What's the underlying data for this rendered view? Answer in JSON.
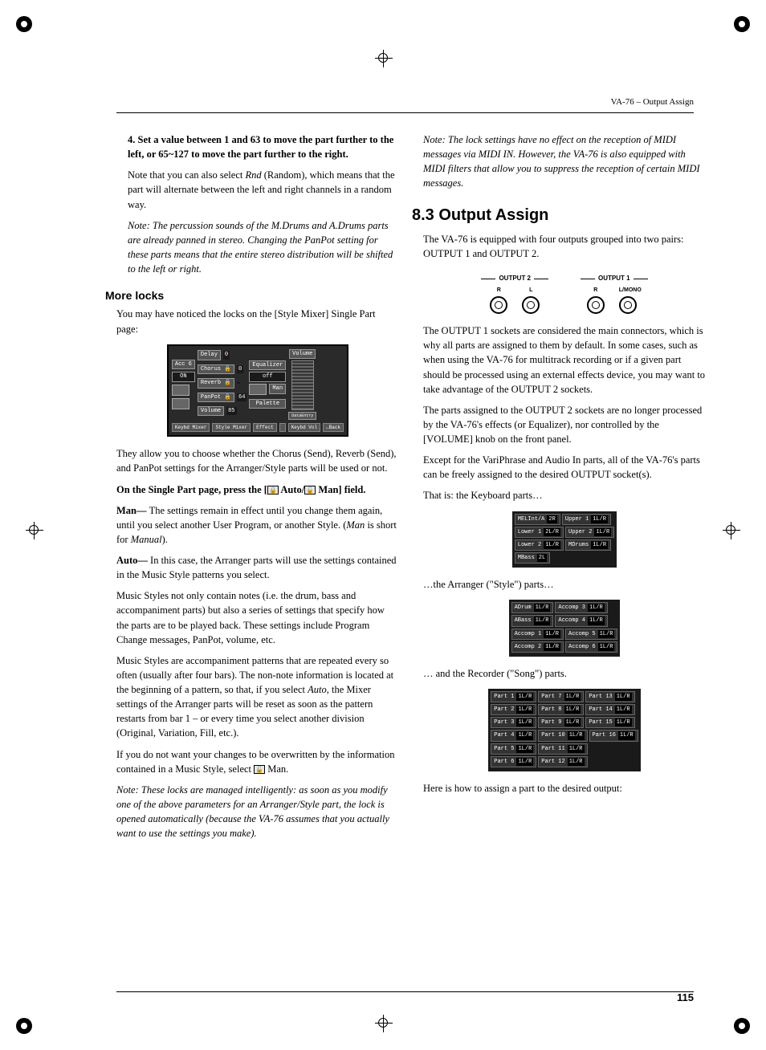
{
  "header": {
    "right": "VA-76 – Output Assign"
  },
  "page_number": "115",
  "left": {
    "step4": "4. Set a value between 1 and 63 to move the part further to the left, or 65~127 to move the part further to the right.",
    "p1a": "Note that you can also select ",
    "p1_rnd": "Rnd",
    "p1b": " (Random), which means that the part will alternate between the left and right channels in a random way.",
    "note1": "Note: The percussion sounds of the M.Drums and A.Drums parts are already panned in stereo. Changing the PanPot setting for these parts means that the entire stereo distribution will be shifted to the left or right.",
    "more_locks_heading": "More locks",
    "ml_p1": "You may have noticed the locks on the [Style Mixer] Single Part page:",
    "lcd": {
      "title": "Acc 6",
      "onoff": "ON",
      "rows": [
        {
          "label": "Delay",
          "val": "0"
        },
        {
          "label": "Chorus 🔒",
          "val": "0"
        },
        {
          "label": "Reverb 🔒",
          "val": ""
        },
        {
          "label": "PanPot 🔒",
          "val": "64"
        },
        {
          "label": "Volume",
          "val": "85"
        }
      ],
      "side": [
        "Equalizer",
        "off",
        "Man",
        "Palette",
        "DataEntry"
      ],
      "volume_col": "Volume",
      "tabs": [
        "Keybd Mixer",
        "Style Mixer",
        "Effect",
        "",
        "Keybd Vol",
        "←Back"
      ]
    },
    "ml_p2": "They allow you to choose whether the Chorus (Send), Reverb (Send), and PanPot settings for the Arranger/Style parts will be used or not.",
    "ml_bold_a": "On the Single Part page, press the [",
    "ml_bold_auto": " Auto/",
    "ml_bold_b": " Man] field.",
    "man_label": "Man— ",
    "man_text": "The settings remain in effect until you change them again, until you select another User Program, or another Style. (",
    "man_i": "Man",
    "man_text2": " is short for ",
    "man_i2": "Manual",
    "man_text3": ").",
    "auto_label": "Auto— ",
    "auto_text": "In this case, the Arranger parts will use the settings contained in the Music Style patterns you select.",
    "ms_p1": "Music Styles not only contain notes (i.e. the drum, bass and accompaniment parts) but also a series of settings that specify how the parts are to be played back. These settings include Program Change messages, PanPot, volume, etc.",
    "ms_p2a": "Music Styles are accompaniment patterns that are repeated every so often (usually after four bars). The non-note information is located at the beginning of a pattern, so that, if you select ",
    "ms_p2_auto": "Auto",
    "ms_p2b": ", the Mixer settings of the Arranger parts will be reset as soon as the pattern restarts from bar 1 – or every time you select another division (Original, Variation, Fill, etc.).",
    "ms_p3a": "If you do not want your changes to be overwritten by the information contained in a Music Style, select ",
    "ms_p3b": " Man.",
    "note2": "Note: These locks are managed intelligently: as soon as you modify one of the above parameters for an Arranger/Style part, the lock is opened automatically (because the VA-76 assumes that you actually want to use the settings you make).",
    "note3": "Note: The lock settings have no effect on the reception of MIDI messages via MIDI IN. However, the VA-76 is also equipped with MIDI filters that allow you to suppress the reception of certain MIDI messages."
  },
  "right": {
    "heading": "8.3 Output Assign",
    "intro": "The VA-76 is equipped with four outputs grouped into two pairs: OUTPUT 1 and OUTPUT 2.",
    "out2": "OUTPUT 2",
    "out1": "OUTPUT 1",
    "lbl_r": "R",
    "lbl_l": "L",
    "lbl_lmono": "L/MONO",
    "p1": "The OUTPUT 1 sockets are considered the main connectors, which is why all parts are assigned to them by default. In some cases, such as when using the VA-76 for multitrack recording or if a given part should be processed using an external effects device, you may want to take advantage of the OUTPUT 2 sockets.",
    "p2": "The parts assigned to the OUTPUT 2 sockets are no longer processed by the VA-76's effects (or Equalizer), nor controlled by the [VOLUME] knob on the front panel.",
    "p3": "Except for the VariPhrase and Audio In parts, all of the VA-76's parts can be freely assigned to the desired OUTPUT socket(s).",
    "p4": "That is: the Keyboard parts…",
    "kbd": [
      [
        "MELInt/A",
        "2R",
        "Upper 1",
        "1L/R"
      ],
      [
        "Lower 1",
        "2L/R",
        "Upper 2",
        "1L/R"
      ],
      [
        "Lower 2",
        "1L/R",
        "MDrums",
        "1L/R"
      ],
      [
        "MBass",
        "2L",
        "",
        ""
      ]
    ],
    "p5": "…the Arranger (\"Style\") parts…",
    "arr": [
      [
        "ADrum",
        "1L/R",
        "Accomp 3",
        "1L/R"
      ],
      [
        "ABass",
        "1L/R",
        "Accomp 4",
        "1L/R"
      ],
      [
        "Accomp 1",
        "1L/R",
        "Accomp 5",
        "1L/R"
      ],
      [
        "Accomp 2",
        "1L/R",
        "Accomp 6",
        "1L/R"
      ]
    ],
    "p6": "… and the Recorder (\"Song\") parts.",
    "song": [
      [
        "Part 1",
        "1L/R",
        "Part 7",
        "1L/R",
        "Part 13",
        "1L/R"
      ],
      [
        "Part 2",
        "1L/R",
        "Part 8",
        "1L/R",
        "Part 14",
        "1L/R"
      ],
      [
        "Part 3",
        "1L/R",
        "Part 9",
        "1L/R",
        "Part 15",
        "1L/R"
      ],
      [
        "Part 4",
        "1L/R",
        "Part 10",
        "1L/R",
        "Part 16",
        "1L/R"
      ],
      [
        "Part 5",
        "1L/R",
        "Part 11",
        "1L/R",
        "",
        ""
      ],
      [
        "Part 6",
        "1L/R",
        "Part 12",
        "1L/R",
        "",
        ""
      ]
    ],
    "p7": "Here is how to assign a part to the desired output:"
  }
}
